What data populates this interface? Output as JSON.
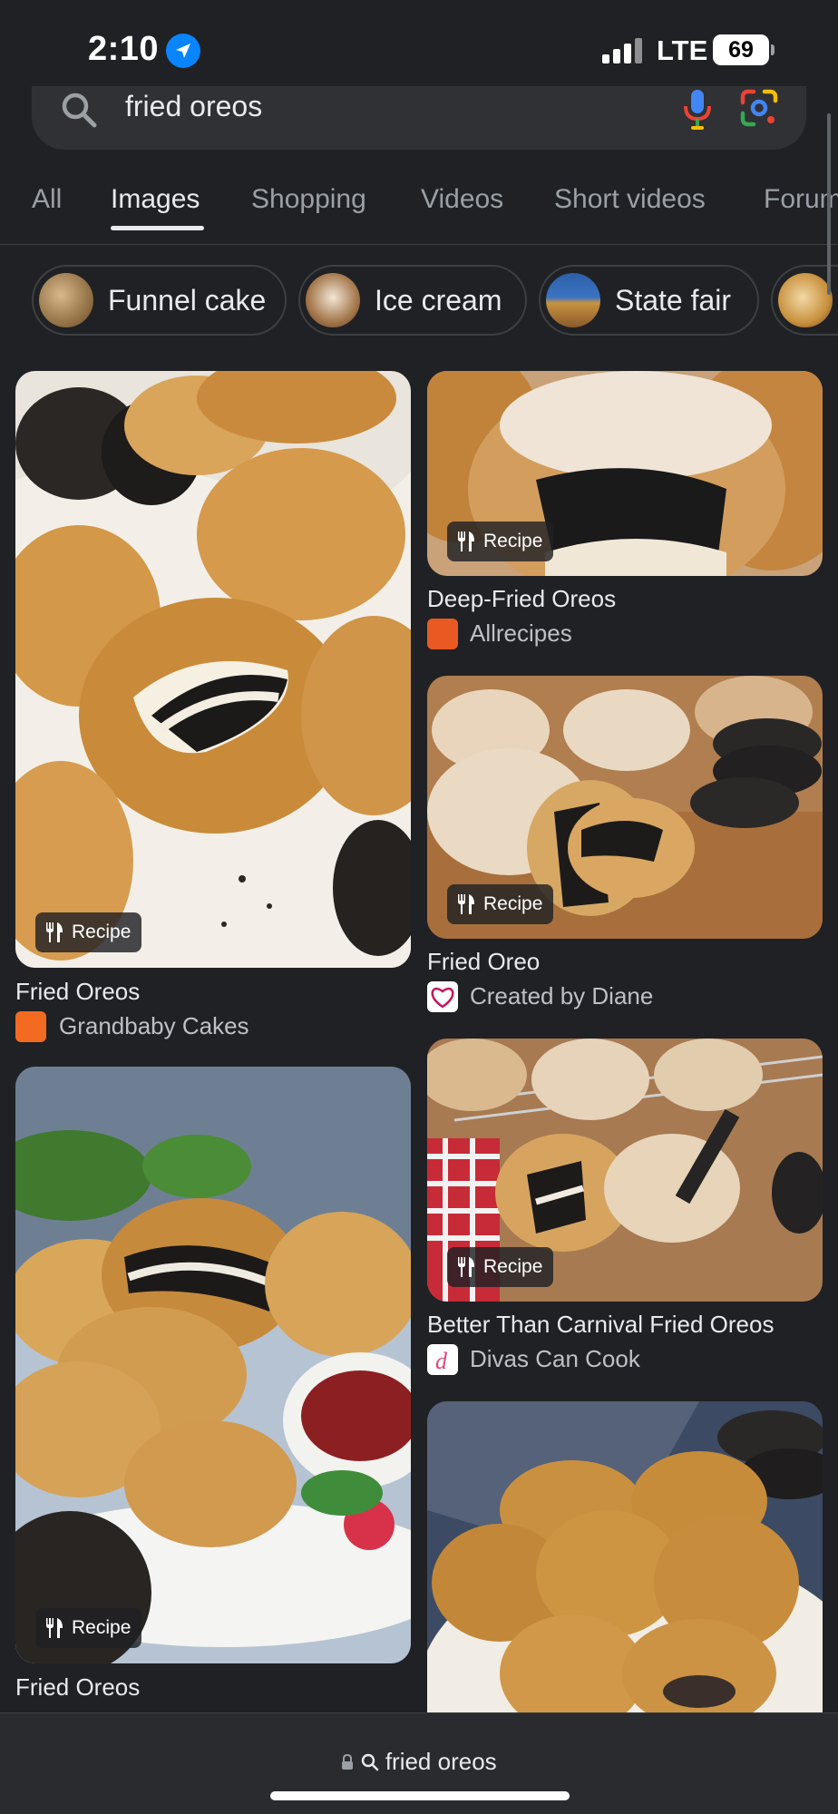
{
  "status_bar": {
    "time": "2:10",
    "network": "LTE",
    "battery": "69"
  },
  "search": {
    "query": "fried oreos"
  },
  "tabs": [
    "All",
    "Images",
    "Shopping",
    "Videos",
    "Short videos",
    "Forums"
  ],
  "active_tab": "Images",
  "chips": [
    {
      "label": "Funnel cake"
    },
    {
      "label": "Ice cream"
    },
    {
      "label": "State fair"
    },
    {
      "label": ""
    }
  ],
  "results": [
    {
      "title": "Fried Oreos",
      "source": "Grandbaby Cakes",
      "badge": "Recipe"
    },
    {
      "title": "Fried Oreos",
      "source": "",
      "badge": "Recipe"
    },
    {
      "title": "Deep-Fried Oreos",
      "source": "Allrecipes",
      "badge": "Recipe"
    },
    {
      "title": "Fried Oreo",
      "source": "Created by Diane",
      "badge": "Recipe"
    },
    {
      "title": "Better Than Carnival Fried Oreos",
      "source": "Divas Can Cook",
      "badge": "Recipe"
    }
  ],
  "bottom_bar": {
    "url": "fried oreos"
  },
  "colors": {
    "background": "#202124",
    "surface": "#303134",
    "text": "#e8eaed",
    "muted": "#9aa0a6"
  }
}
